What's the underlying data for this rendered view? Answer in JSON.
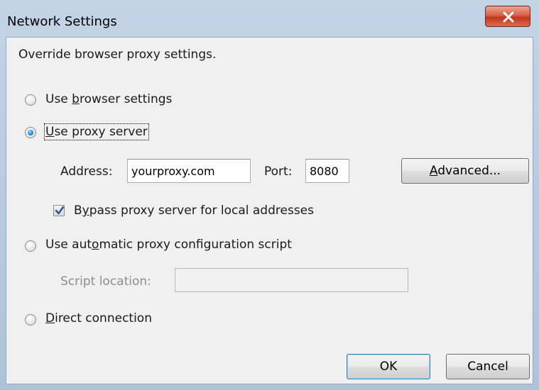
{
  "window": {
    "title": "Network Settings",
    "close_icon": "close-icon"
  },
  "description": "Override browser proxy settings.",
  "proxy_options": {
    "browser_settings": {
      "label_pre": "Use ",
      "label_accel": "b",
      "label_post": "rowser settings",
      "checked": false
    },
    "proxy_server": {
      "label_pre": "",
      "label_accel": "U",
      "label_post": "se proxy server",
      "checked": true
    },
    "automatic_script": {
      "label_pre": "Use aut",
      "label_accel": "o",
      "label_post": "matic proxy configuration script",
      "checked": false
    },
    "direct_connection": {
      "label_pre": "",
      "label_accel": "D",
      "label_post": "irect connection",
      "checked": false
    }
  },
  "proxy_server": {
    "address_label": "Address:",
    "address_value": "yourproxy.com",
    "port_label": "Port:",
    "port_value": "8080",
    "advanced_pre": "",
    "advanced_accel": "A",
    "advanced_post": "dvanced...",
    "bypass_pre": "B",
    "bypass_accel": "y",
    "bypass_post": "pass proxy server for local addresses",
    "bypass_checked": true
  },
  "automatic_script": {
    "script_location_label": "Script location:",
    "script_location_value": ""
  },
  "buttons": {
    "ok": "OK",
    "cancel": "Cancel"
  }
}
